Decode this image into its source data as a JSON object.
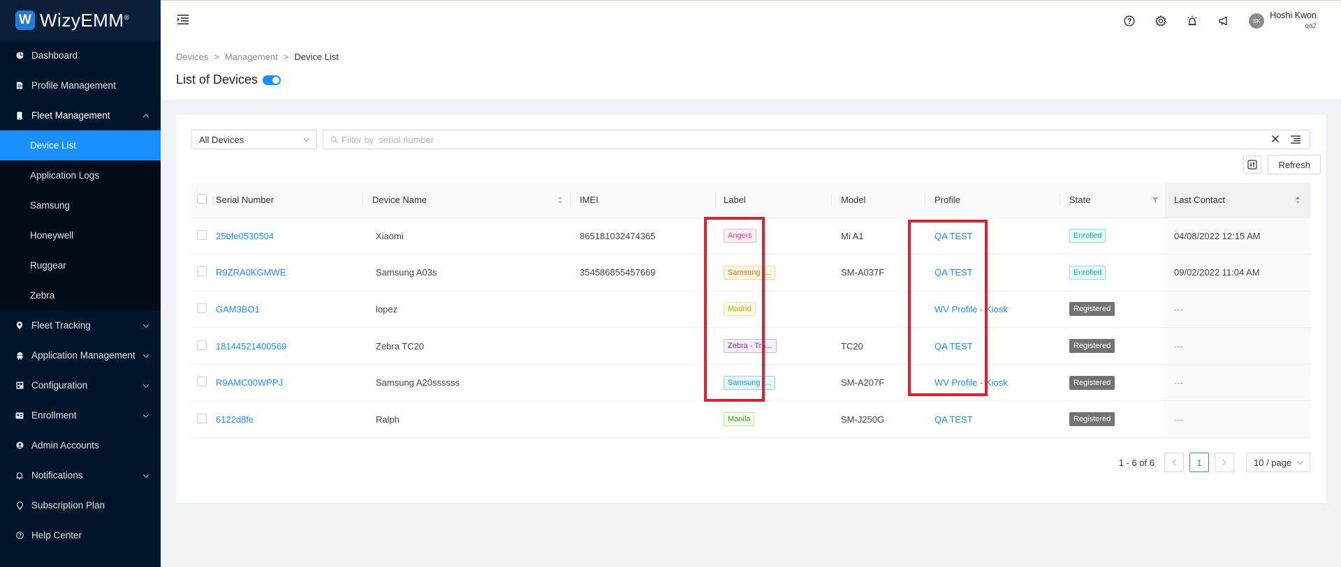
{
  "brand": {
    "logo_letter": "W",
    "name": "WizyEMM",
    "mark": "®"
  },
  "sidebar": {
    "items": [
      {
        "label": "Dashboard",
        "icon": "pie-chart-icon",
        "has_children": false
      },
      {
        "label": "Profile Management",
        "icon": "document-icon",
        "has_children": false
      },
      {
        "label": "Fleet Management",
        "icon": "phone-icon",
        "has_children": true,
        "expanded": true,
        "children": [
          "Device List",
          "Application Logs",
          "Samsung",
          "Honeywell",
          "Ruggear",
          "Zebra"
        ],
        "selected_child": "Device List"
      },
      {
        "label": "Fleet Tracking",
        "icon": "location-pin-icon",
        "has_children": true
      },
      {
        "label": "Application Management",
        "icon": "android-icon",
        "has_children": true
      },
      {
        "label": "Configuration",
        "icon": "grid-icon",
        "has_children": true
      },
      {
        "label": "Enrollment",
        "icon": "id-card-icon",
        "has_children": true
      },
      {
        "label": "Admin Accounts",
        "icon": "user-circle-icon",
        "has_children": false
      },
      {
        "label": "Notifications",
        "icon": "bell-icon",
        "has_children": true
      },
      {
        "label": "Subscription Plan",
        "icon": "bulb-icon",
        "has_children": false
      },
      {
        "label": "Help Center",
        "icon": "question-circle-icon",
        "has_children": false
      }
    ]
  },
  "header": {
    "icons": [
      "help-icon",
      "settings-icon",
      "alarm-icon",
      "megaphone-icon"
    ],
    "user": {
      "initials": "SK",
      "name": "Hoshi Kwon",
      "org": "qa2"
    }
  },
  "breadcrumb": [
    "Devices",
    "Management",
    "Device List"
  ],
  "page": {
    "title": "List of Devices",
    "toggle_on": true
  },
  "toolbar": {
    "device_filter": "All Devices",
    "search_placeholder": "Filter by  serial number",
    "refresh_label": "Refresh"
  },
  "table": {
    "columns": [
      "Serial Number",
      "Device Name",
      "IMEI",
      "Label",
      "Model",
      "Profile",
      "State",
      "Last Contact"
    ],
    "rows": [
      {
        "serial": "25bfe0530504",
        "name": "Xiaomi",
        "imei": "865181032474365",
        "label": "Angers",
        "label_color": "pink",
        "model": "Mi A1",
        "profile": "QA TEST",
        "state": "Enrolled",
        "last_contact": "04/08/2022 12:15 AM"
      },
      {
        "serial": "R9ZRA0KGMWE",
        "name": "Samsung A03s",
        "imei": "354586855457669",
        "label": "Samsung -...",
        "label_color": "orange",
        "model": "SM-A037F",
        "profile": "QA TEST",
        "state": "Enrolled",
        "last_contact": "09/02/2022 11:04 AM"
      },
      {
        "serial": "GAM3BO1",
        "name": "lopez",
        "imei": "",
        "label": "Madrid",
        "label_color": "gold",
        "model": "",
        "profile": "WV Profile - Kiosk",
        "state": "Registered",
        "last_contact": "---"
      },
      {
        "serial": "18144521400569",
        "name": "Zebra TC20",
        "imei": "",
        "label": "Zebra - Tra...",
        "label_color": "purple",
        "model": "TC20",
        "profile": "QA TEST",
        "state": "Registered",
        "last_contact": "---"
      },
      {
        "serial": "R9AMC00WPPJ",
        "name": "Samsung A20ssssss",
        "imei": "",
        "label": "Samsung -...",
        "label_color": "blue",
        "model": "SM-A207F",
        "profile": "WV Profile - Kiosk",
        "state": "Registered",
        "last_contact": "---"
      },
      {
        "serial": "6122d8fe",
        "name": "Ralph",
        "imei": "",
        "label": "Manila",
        "label_color": "green",
        "model": "SM-J250G",
        "profile": "QA TEST",
        "state": "Registered",
        "last_contact": "---"
      }
    ]
  },
  "pagination": {
    "range": "1 - 6 of 6",
    "current_page": "1",
    "page_size": "10 / page"
  },
  "colors": {
    "sidebar_bg": "#001529",
    "primary": "#1890ff",
    "highlight": "#e0202a",
    "tag_pink": [
      "#ffadd2",
      "#eb2f96",
      "#fff0f6"
    ],
    "tag_orange": [
      "#ffd591",
      "#d46b08",
      "#fff7e6"
    ],
    "tag_gold": [
      "#ffe58f",
      "#d4a106",
      "#fffbe6"
    ],
    "tag_purple": [
      "#d3adf7",
      "#722ed1",
      "#f9f0ff"
    ],
    "tag_blue": [
      "#91d5ff",
      "#1890ff",
      "#e6f7ff"
    ],
    "tag_green": [
      "#b7eb8f",
      "#389e0d",
      "#f6ffed"
    ]
  }
}
